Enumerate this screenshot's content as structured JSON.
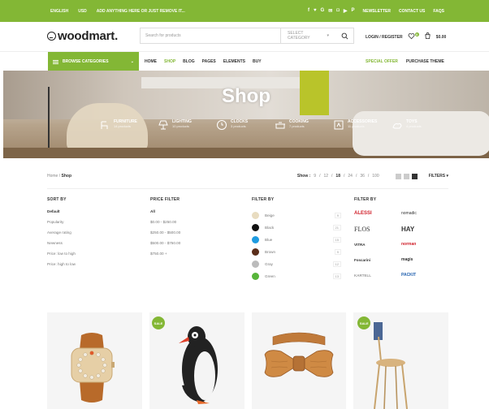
{
  "topbar": {
    "language": "ENGLISH",
    "currency": "USD",
    "promo": "ADD ANYTHING HERE OR JUST REMOVE IT...",
    "social_icons": [
      "facebook-icon",
      "twitter-icon",
      "google-plus-icon",
      "email-icon",
      "instagram-icon",
      "youtube-icon",
      "pinterest-icon"
    ],
    "newsletter": "NEWSLETTER",
    "contact": "CONTACT US",
    "faqs": "FAQS"
  },
  "header": {
    "logo": "woodmart.",
    "search_placeholder": "Search for products",
    "search_category": "SELECT CATEGORY",
    "login": "LOGIN / REGISTER",
    "wishlist_count": "0",
    "cart_total": "$0.00"
  },
  "nav": {
    "browse": "BROWSE CATEGORIES",
    "items": [
      "HOME",
      "SHOP",
      "BLOG",
      "PAGES",
      "ELEMENTS",
      "BUY"
    ],
    "special_offer": "SPECIAL OFFER",
    "purchase_theme": "PURCHASE THEME"
  },
  "hero": {
    "title": "Shop",
    "categories": [
      {
        "name": "FURNITURE",
        "count": "14 products"
      },
      {
        "name": "LIGHTING",
        "count": "10 products"
      },
      {
        "name": "CLOCKS",
        "count": "3 products"
      },
      {
        "name": "COOKING",
        "count": "7 products"
      },
      {
        "name": "ACCESSORIES",
        "count": "11 products"
      },
      {
        "name": "TOYS",
        "count": "4 products"
      }
    ]
  },
  "toolbar": {
    "breadcrumb_home": "Home",
    "breadcrumb_current": "Shop",
    "show_label": "Show :",
    "show_options": [
      "9",
      "12",
      "18",
      "24",
      "36",
      "100"
    ],
    "show_current": "18",
    "filters": "FILTERS"
  },
  "filters": {
    "sort": {
      "title": "SORT BY",
      "options": [
        "Default",
        "Popularity",
        "Average rating",
        "Newness",
        "Price: low to high",
        "Price: high to low"
      ]
    },
    "price": {
      "title": "PRICE FILTER",
      "options": [
        "All",
        "$0.00 - $250.00",
        "$250.00 - $500.00",
        "$500.00 - $750.00",
        "$750.00 +"
      ]
    },
    "color": {
      "title": "FILTER BY",
      "items": [
        {
          "name": "Beige",
          "count": "9",
          "hex": "#e8dcc0"
        },
        {
          "name": "Black",
          "count": "21",
          "hex": "#111111"
        },
        {
          "name": "Blue",
          "count": "15",
          "hex": "#1e9be0"
        },
        {
          "name": "Brown",
          "count": "9",
          "hex": "#5a2d1a"
        },
        {
          "name": "Gray",
          "count": "12",
          "hex": "#bbbbbb"
        },
        {
          "name": "Green",
          "count": "13",
          "hex": "#57b53a"
        }
      ]
    },
    "brand": {
      "title": "FILTER BY",
      "items": [
        {
          "name": "ALESSI",
          "color": "#d0202a"
        },
        {
          "name": "nomadic",
          "color": "#333333"
        },
        {
          "name": "FLOS",
          "color": "#333333"
        },
        {
          "name": "HAY",
          "color": "#111111"
        },
        {
          "name": "VITRA",
          "color": "#333333"
        },
        {
          "name": "norman",
          "color": "#d0202a"
        },
        {
          "name": "Foscarini",
          "color": "#333333"
        },
        {
          "name": "magis",
          "color": "#333333"
        },
        {
          "name": "KARTELL",
          "color": "#999999"
        },
        {
          "name": "PACKIT",
          "color": "#1f5fae"
        }
      ]
    }
  },
  "products": [
    {
      "sale": false
    },
    {
      "sale": false
    },
    {
      "sale": false
    },
    {
      "sale": false
    }
  ],
  "sale_label": "SALE",
  "colors": {
    "accent": "#83b735"
  }
}
